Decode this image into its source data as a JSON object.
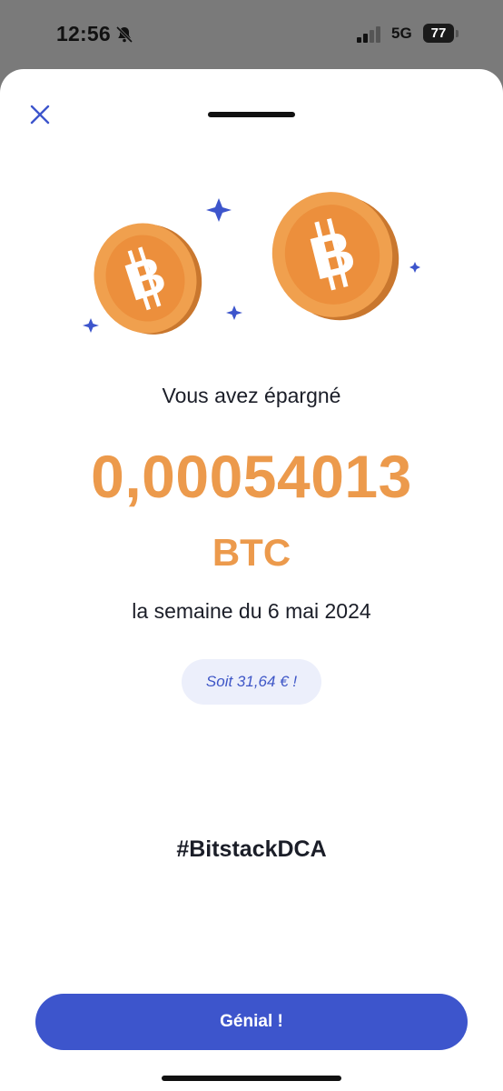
{
  "status_bar": {
    "time": "12:56",
    "network": "5G",
    "battery": "77"
  },
  "icons": {
    "close": "close-icon",
    "bell": "bell-slash-icon",
    "signal": "cellular-signal-icon",
    "battery": "battery-icon",
    "coin": "bitcoin-coin-icon",
    "sparkle": "sparkle-star-icon"
  },
  "colors": {
    "accent": "#3d55cc",
    "amount": "#ec9a4c",
    "coin_light": "#f0a04e",
    "coin_dark": "#c9772e",
    "pill_bg": "#eceffb"
  },
  "savings": {
    "label": "Vous avez épargné",
    "amount": "0,00054013",
    "unit": "BTC",
    "period": "la semaine du 6 mai 2024",
    "fiat_equivalent": "Soit 31,64 € !"
  },
  "hashtag": "#BitstackDCA",
  "cta_label": "Génial !"
}
